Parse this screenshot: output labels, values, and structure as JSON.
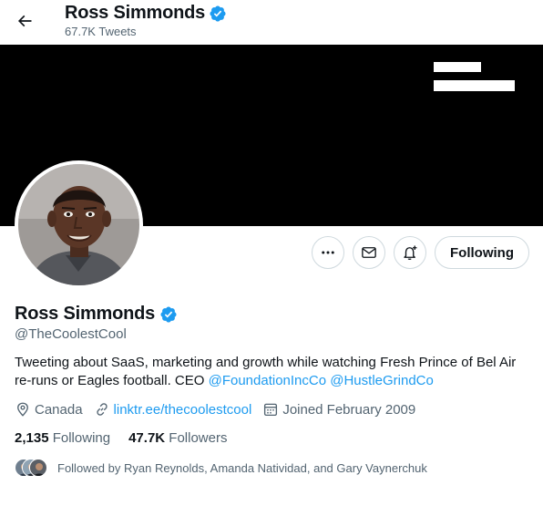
{
  "header": {
    "name": "Ross Simmonds",
    "tweet_count": "67.7K Tweets"
  },
  "profile": {
    "name": "Ross Simmonds",
    "handle": "@TheCoolestCool",
    "bio_text": "Tweeting about SaaS, marketing and growth while watching Fresh Prince of Bel Air re-runs or Eagles football. CEO ",
    "bio_mention_1": "@FoundationIncCo",
    "bio_mention_2": "@HustleGrindCo",
    "location": "Canada",
    "website": "linktr.ee/thecoolestcool",
    "joined": "Joined February 2009"
  },
  "actions": {
    "follow_label": "Following",
    "more_icon": "more-icon",
    "message_icon": "mail-icon",
    "notify_icon": "bell-plus-icon"
  },
  "stats": {
    "following_count": "2,135",
    "following_label": "Following",
    "followers_count": "47.7K",
    "followers_label": "Followers"
  },
  "followed_by": "Followed by Ryan Reynolds, Amanda Natividad, and Gary Vaynerchuk",
  "colors": {
    "accent": "#1d9bf0",
    "text": "#0f1419",
    "muted": "#536471",
    "border": "#cfd9de",
    "banner": "#000000"
  }
}
